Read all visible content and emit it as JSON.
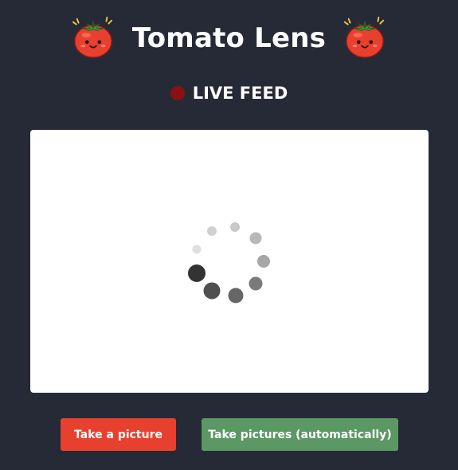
{
  "header": {
    "title": "Tomato Lens",
    "left_icon": "tomato-face-icon",
    "right_icon": "tomato-face-icon"
  },
  "live_indicator": {
    "label": "LIVE FEED",
    "dot_color": "#8b1014"
  },
  "video": {
    "state": "loading",
    "loading_icon": "loading-spinner-icon"
  },
  "buttons": {
    "take_picture": "Take a picture",
    "take_pictures_auto": "Take pictures (automatically)"
  },
  "colors": {
    "background": "#262a36",
    "take_picture_button": "#e8402e",
    "auto_button": "#5b9864",
    "tomato_red": "#e8402e"
  }
}
